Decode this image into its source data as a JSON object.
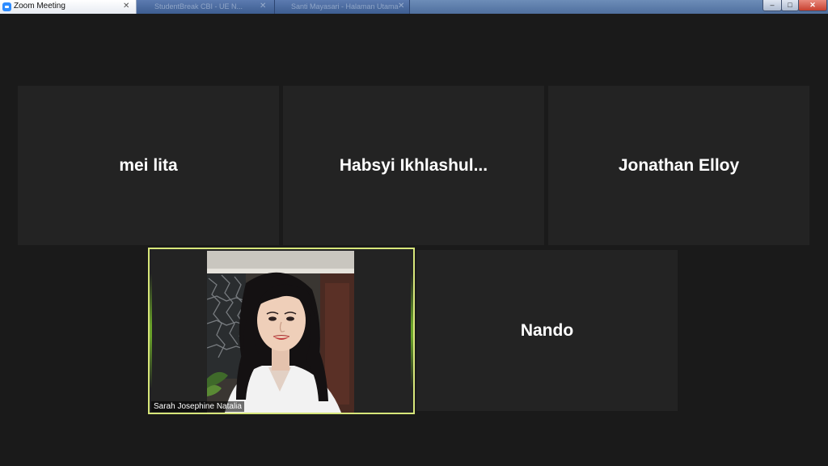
{
  "window": {
    "title": "Zoom Meeting",
    "tab_close": "✕",
    "background_tabs": [
      {
        "label": "StudentBreak CBI - UE N...",
        "close": "✕"
      },
      {
        "label": "Santi Mayasari - Halaman Utama",
        "close": "✕"
      }
    ],
    "controls": {
      "minimize": "–",
      "maximize": "□",
      "close": "✕"
    }
  },
  "participants": [
    {
      "name": "mei lita",
      "video": false
    },
    {
      "name": "Habsyi  Ikhlashul...",
      "video": false
    },
    {
      "name": "Jonathan Elloy",
      "video": false
    },
    {
      "name": "Sarah Josephine Natalia",
      "video": true,
      "active_speaker": true
    },
    {
      "name": "Nando",
      "video": false
    }
  ],
  "colors": {
    "background": "#1a1a1a",
    "tile": "#232323",
    "active_border": "#d7e67a"
  }
}
